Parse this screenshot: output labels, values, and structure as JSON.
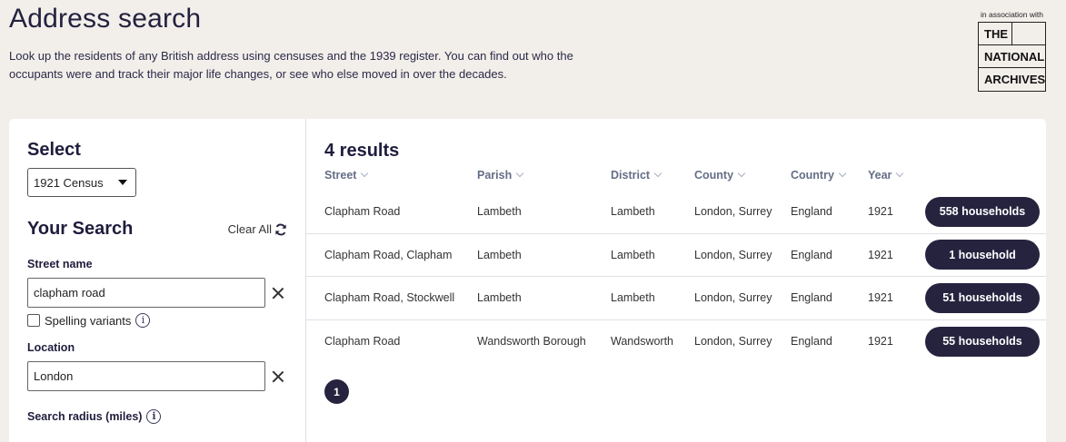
{
  "header": {
    "title": "Address search",
    "intro_line1": "Look up the residents of any British address using censuses and the 1939 register. You can find out who the",
    "intro_line2": "occupants were and track their major life changes, or see who else moved in over the decades."
  },
  "partner": {
    "assoc_text": "in association with",
    "logo_words": [
      "THE",
      "NATIONAL",
      "ARCHIVES"
    ]
  },
  "sidebar": {
    "select_heading": "Select",
    "census_selected": "1921 Census",
    "your_search_heading": "Your Search",
    "clear_all": "Clear All",
    "street_label": "Street name",
    "street_value": "clapham road",
    "spelling_variants": "Spelling variants",
    "location_label": "Location",
    "location_value": "London",
    "radius_label": "Search radius (miles)"
  },
  "results": {
    "count_label": "4 results",
    "columns": [
      "Street",
      "Parish",
      "District",
      "County",
      "Country",
      "Year"
    ],
    "rows": [
      {
        "street": "Clapham Road",
        "parish": "Lambeth",
        "district": "Lambeth",
        "county": "London, Surrey",
        "country": "England",
        "year": "1921",
        "households": "558 households"
      },
      {
        "street": "Clapham Road, Clapham",
        "parish": "Lambeth",
        "district": "Lambeth",
        "county": "London, Surrey",
        "country": "England",
        "year": "1921",
        "households": "1 household"
      },
      {
        "street": "Clapham Road, Stockwell",
        "parish": "Lambeth",
        "district": "Lambeth",
        "county": "London, Surrey",
        "country": "England",
        "year": "1921",
        "households": "51 households"
      },
      {
        "street": "Clapham Road",
        "parish": "Wandsworth Borough",
        "district": "Wandsworth",
        "county": "London, Surrey",
        "country": "England",
        "year": "1921",
        "households": "55 households"
      }
    ],
    "current_page": "1"
  },
  "colors": {
    "page_bg": "#f2efeb",
    "primary_dark": "#26233f",
    "header_text": "#646e86"
  }
}
